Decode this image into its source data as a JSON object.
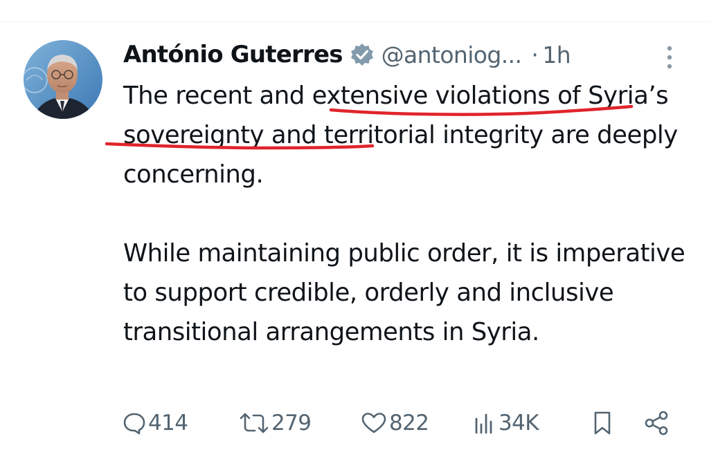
{
  "tweet": {
    "author_name": "António Guterres",
    "handle": "@antoniog...",
    "separator": "·",
    "time": "1h",
    "paragraph_1": "The recent and extensive violations of Syria’s sovereignty and territorial integrity are deeply concerning.",
    "paragraph_2": "While maintaining public order, it is imperative to support credible, orderly and inclusive transitional arrangements in Syria."
  },
  "annotation": {
    "underline_color": "#e0242b",
    "underlined_phrases": [
      "extensive violations of",
      "Syria’s sovereignty"
    ]
  },
  "actions": {
    "replies": "414",
    "reposts": "279",
    "likes": "822",
    "views": "34K"
  },
  "colors": {
    "text": "#0f1419",
    "secondary": "#536471",
    "verified_badge": "#829aab"
  },
  "icons": [
    "verified-badge-icon",
    "more-options-icon",
    "reply-icon",
    "repost-icon",
    "like-icon",
    "views-icon",
    "bookmark-icon",
    "share-icon"
  ]
}
